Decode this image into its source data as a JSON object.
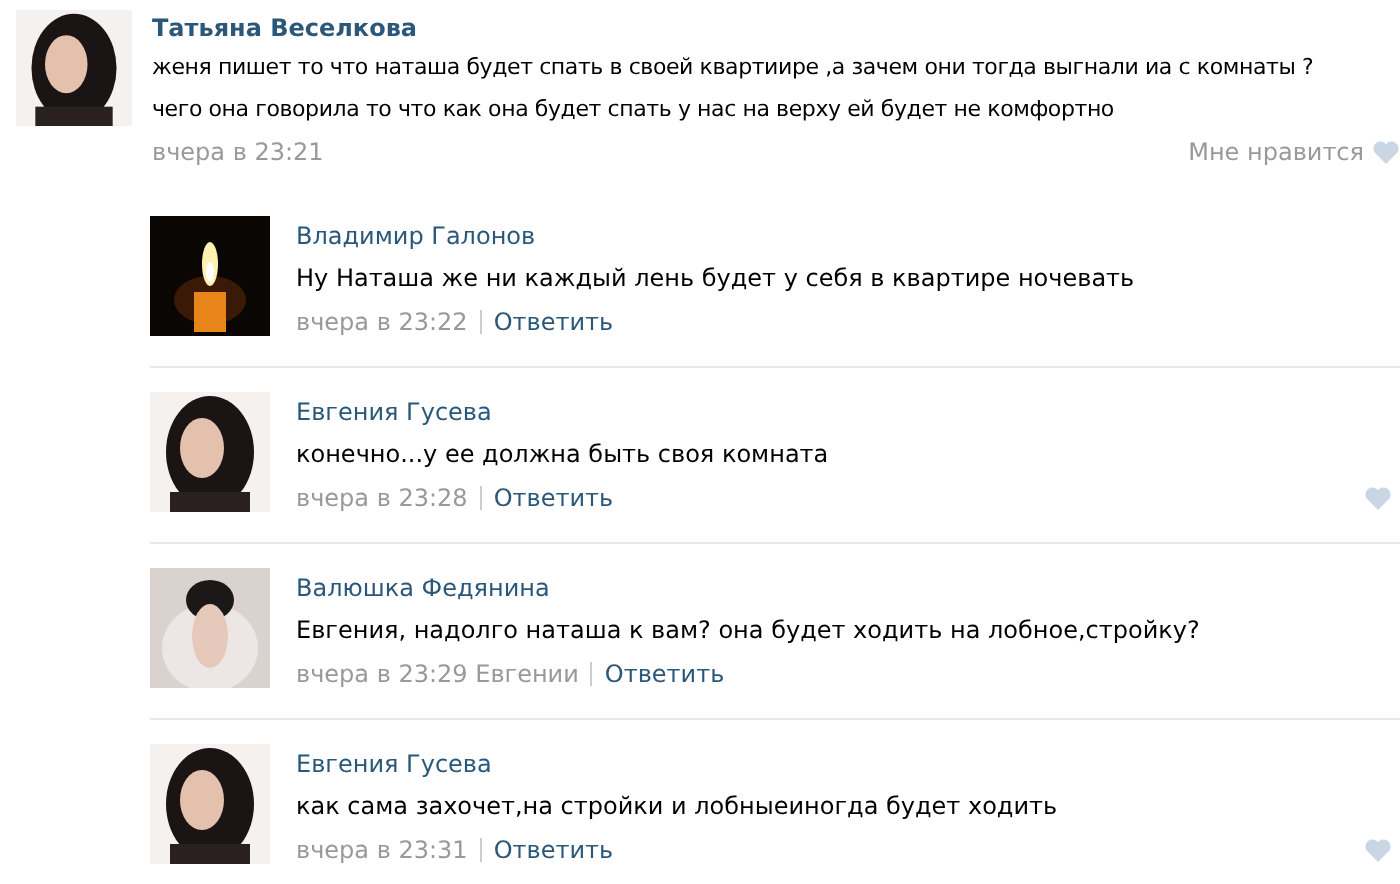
{
  "post": {
    "author": "Татьяна Веселкова",
    "text": "женя пишет то что наташа будет спать в своей квартиире ,а зачем они тогда выгнали иа с комнаты ?\nчего она говорила то что как она будет спать у нас на верху ей будет не комфортно",
    "time": "вчера в 23:21",
    "like_label": "Мне нравится"
  },
  "replies": [
    {
      "author": "Владимир Галонов",
      "text": "Ну Наташа же ни каждый лень будет у себя в квартире ночевать",
      "meta": "вчера в 23:22",
      "reply_link": "Ответить",
      "like_shown": false
    },
    {
      "author": "Евгения Гусева",
      "text": "конечно...у ее должна быть своя комната",
      "meta": "вчера в 23:28",
      "reply_link": "Ответить",
      "like_shown": true
    },
    {
      "author": "Валюшка Федянина",
      "text": "Евгения, надолго наташа к вам? она будет ходить на лобное,стройку?",
      "meta": "вчера в 23:29 Евгении",
      "reply_link": "Ответить",
      "like_shown": false
    },
    {
      "author": "Евгения Гусева",
      "text": "как сама захочет,на стройки и лобныеиногда будет ходить",
      "meta": "вчера в 23:31",
      "reply_link": "Ответить",
      "like_shown": true
    }
  ]
}
